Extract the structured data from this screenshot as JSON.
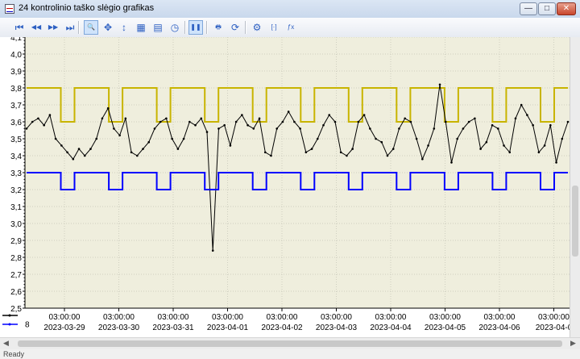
{
  "window": {
    "title": "24 kontrolinio taško slėgio grafikas",
    "minimize": "—",
    "maximize": "□",
    "close": "✕"
  },
  "toolbar": [
    {
      "icon": "first-page-icon",
      "glyph": "⏮"
    },
    {
      "icon": "previous-page-icon",
      "glyph": "◀◀"
    },
    {
      "icon": "next-page-icon",
      "glyph": "▶▶"
    },
    {
      "icon": "last-page-icon",
      "glyph": "⏭"
    },
    {
      "icon": "zoom-icon",
      "glyph": "🔍",
      "selected": true
    },
    {
      "icon": "pan-icon",
      "glyph": "✥"
    },
    {
      "icon": "vertical-scale-icon",
      "glyph": "↕"
    },
    {
      "icon": "fit-all-icon",
      "glyph": "▦"
    },
    {
      "icon": "grid-icon",
      "glyph": "▤"
    },
    {
      "icon": "clock-icon",
      "glyph": "◷"
    },
    {
      "icon": "pause-icon",
      "glyph": "❚❚",
      "selected": true
    },
    {
      "icon": "print-icon",
      "glyph": "🖶"
    },
    {
      "icon": "export-icon",
      "glyph": "⟳"
    },
    {
      "icon": "settings-icon",
      "glyph": "⚙"
    },
    {
      "icon": "bracket-icon",
      "glyph": "[·]"
    },
    {
      "icon": "formula-icon",
      "glyph": "ƒx"
    }
  ],
  "legend": [
    {
      "label": "",
      "color": "#000000"
    },
    {
      "label": "8",
      "color": "#0000ff"
    }
  ],
  "status": {
    "text": "Ready"
  },
  "chart_data": {
    "type": "line",
    "ylim": [
      2.5,
      4.1
    ],
    "yticks": [
      "4,1",
      "4,0",
      "3,9",
      "3,8",
      "3,7",
      "3,6",
      "3,5",
      "3,4",
      "3,3",
      "3,2",
      "3,1",
      "3,0",
      "2,9",
      "2,8",
      "2,7",
      "2,6",
      "2,5"
    ],
    "xticks": [
      {
        "time": "03:00:00",
        "date": "2023-03-29"
      },
      {
        "time": "03:00:00",
        "date": "2023-03-30"
      },
      {
        "time": "03:00:00",
        "date": "2023-03-31"
      },
      {
        "time": "03:00:00",
        "date": "2023-04-01"
      },
      {
        "time": "03:00:00",
        "date": "2023-04-02"
      },
      {
        "time": "03:00:00",
        "date": "2023-04-03"
      },
      {
        "time": "03:00:00",
        "date": "2023-04-04"
      },
      {
        "time": "03:00:00",
        "date": "2023-04-05"
      },
      {
        "time": "03:00:00",
        "date": "2023-04-06"
      },
      {
        "time": "03:00:00",
        "date": "2023-04-0"
      }
    ],
    "grid": true,
    "series": [
      {
        "color": "#c8b400",
        "values": [
          3.8,
          3.8,
          3.8,
          3.8,
          3.8,
          3.6,
          3.6,
          3.8,
          3.8,
          3.8,
          3.8,
          3.8,
          3.6,
          3.6,
          3.8,
          3.8,
          3.8,
          3.8,
          3.8,
          3.6,
          3.6,
          3.8,
          3.8,
          3.8,
          3.8,
          3.8,
          3.6,
          3.6,
          3.8,
          3.8,
          3.8,
          3.8,
          3.8,
          3.6,
          3.6,
          3.8,
          3.8,
          3.8,
          3.8,
          3.8,
          3.6,
          3.6,
          3.8,
          3.8,
          3.8,
          3.8,
          3.8,
          3.6,
          3.6,
          3.8,
          3.8,
          3.8,
          3.8,
          3.8,
          3.6,
          3.6,
          3.8,
          3.8,
          3.8,
          3.8,
          3.8,
          3.6,
          3.6,
          3.8,
          3.8,
          3.8,
          3.8,
          3.8,
          3.6,
          3.6,
          3.8,
          3.8,
          3.8,
          3.8,
          3.8,
          3.6,
          3.6,
          3.8,
          3.8,
          3.8
        ]
      },
      {
        "color": "#000000",
        "marker": "dot",
        "values": [
          3.56,
          3.6,
          3.62,
          3.58,
          3.64,
          3.5,
          3.46,
          3.42,
          3.38,
          3.44,
          3.4,
          3.44,
          3.5,
          3.62,
          3.68,
          3.56,
          3.52,
          3.62,
          3.42,
          3.4,
          3.44,
          3.48,
          3.56,
          3.6,
          3.62,
          3.5,
          3.44,
          3.5,
          3.6,
          3.58,
          3.62,
          3.54,
          2.84,
          3.56,
          3.58,
          3.46,
          3.6,
          3.64,
          3.58,
          3.56,
          3.62,
          3.42,
          3.4,
          3.56,
          3.6,
          3.66,
          3.6,
          3.56,
          3.42,
          3.44,
          3.5,
          3.58,
          3.64,
          3.6,
          3.42,
          3.4,
          3.44,
          3.6,
          3.64,
          3.56,
          3.5,
          3.48,
          3.4,
          3.44,
          3.56,
          3.62,
          3.6,
          3.5,
          3.38,
          3.46,
          3.56,
          3.82,
          3.6,
          3.36,
          3.5,
          3.56,
          3.6,
          3.62,
          3.44,
          3.48,
          3.58,
          3.56,
          3.46,
          3.42,
          3.62,
          3.7,
          3.64,
          3.58,
          3.42,
          3.46,
          3.58,
          3.36,
          3.5,
          3.6
        ]
      },
      {
        "color": "#0000ff",
        "values": [
          3.3,
          3.3,
          3.3,
          3.3,
          3.3,
          3.2,
          3.2,
          3.3,
          3.3,
          3.3,
          3.3,
          3.3,
          3.2,
          3.2,
          3.3,
          3.3,
          3.3,
          3.3,
          3.3,
          3.2,
          3.2,
          3.3,
          3.3,
          3.3,
          3.3,
          3.3,
          3.2,
          3.2,
          3.3,
          3.3,
          3.3,
          3.3,
          3.3,
          3.2,
          3.2,
          3.3,
          3.3,
          3.3,
          3.3,
          3.3,
          3.2,
          3.2,
          3.3,
          3.3,
          3.3,
          3.3,
          3.3,
          3.2,
          3.2,
          3.3,
          3.3,
          3.3,
          3.3,
          3.3,
          3.2,
          3.2,
          3.3,
          3.3,
          3.3,
          3.3,
          3.3,
          3.2,
          3.2,
          3.3,
          3.3,
          3.3,
          3.3,
          3.3,
          3.2,
          3.2,
          3.3,
          3.3,
          3.3,
          3.3,
          3.3,
          3.2,
          3.2,
          3.3,
          3.3,
          3.3
        ]
      }
    ]
  }
}
